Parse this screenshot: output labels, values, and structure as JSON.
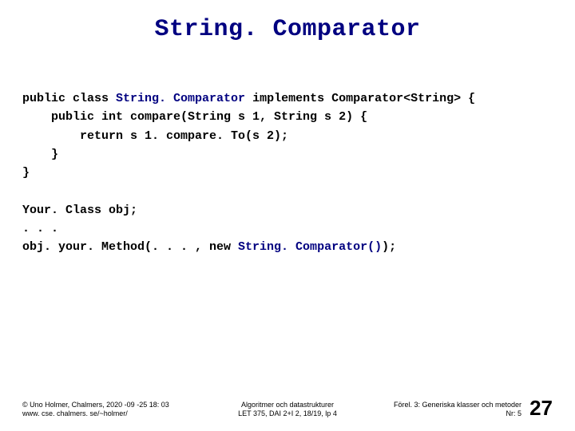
{
  "title": "String. Comparator",
  "code": {
    "line1_pre": "public class ",
    "line1_class": "String. Comparator",
    "line1_post": " implements Comparator<String> {",
    "line2": "    public int compare(String s 1, String s 2) {",
    "line3": "        return s 1. compare. To(s 2);",
    "line4": "    }",
    "line5": "}",
    "line6": "",
    "line7": "Your. Class obj;",
    "line8": ". . .",
    "line9_pre": "obj. your. Method(. . . , new ",
    "line9_call": "String. Comparator()",
    "line9_post": ");"
  },
  "footer": {
    "left_line1": "© Uno Holmer, Chalmers, 2020 -09 -25 18: 03",
    "left_line2": "www. cse. chalmers. se/~holmer/",
    "center_line1": "Algoritmer och datastrukturer",
    "center_line2": "LET 375, DAI 2+I 2, 18/19, lp 4",
    "right_line1": "Förel. 3: Generiska klasser och metoder",
    "right_line2": "Nr: 5",
    "page_number": "27"
  }
}
